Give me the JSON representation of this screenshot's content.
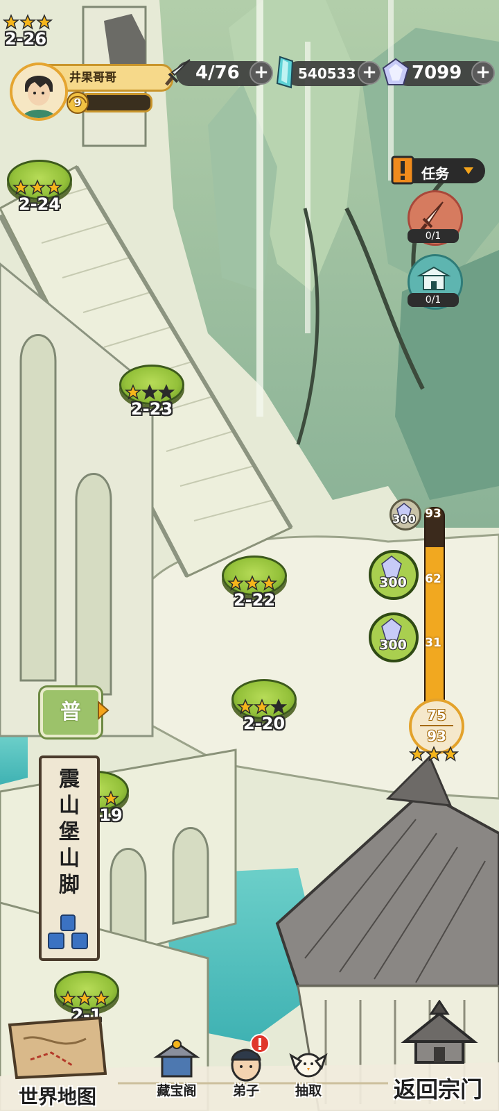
{
  "player": {
    "name": "井果哥哥",
    "level": "9",
    "exp_fraction": 0.08
  },
  "resources": {
    "stamina": {
      "value": "4/76",
      "icon": "sword-icon"
    },
    "jade": {
      "value": "540533",
      "icon": "jade-crystal-icon"
    },
    "gems": {
      "value": "7099",
      "icon": "gem-icon"
    }
  },
  "quest": {
    "label": "任务",
    "items": [
      {
        "icon": "sword-icon",
        "count": "0/1"
      },
      {
        "icon": "temple-icon",
        "count": "0/1"
      }
    ]
  },
  "stages": [
    {
      "id": "s26",
      "label": "2-26",
      "stars": 3
    },
    {
      "id": "s24",
      "label": "2-24",
      "stars": 3
    },
    {
      "id": "s23",
      "label": "2-23",
      "stars": 1
    },
    {
      "id": "s22",
      "label": "2-22",
      "stars": 3
    },
    {
      "id": "s20",
      "label": "2-20",
      "stars": 2
    },
    {
      "id": "s19",
      "label": "19",
      "stars": 3
    },
    {
      "id": "s1x",
      "label": "2-1",
      "stars": 3
    }
  ],
  "progress": {
    "current": "75",
    "total": "93",
    "milestones": [
      {
        "value": "93",
        "reward": "300"
      },
      {
        "value": "62",
        "reward": "300"
      },
      {
        "value": "31",
        "reward": "300"
      }
    ],
    "fraction": 0.806
  },
  "mode_badge": "普",
  "area_name": [
    "震",
    "山",
    "堡",
    "山",
    "脚"
  ],
  "bottom_nav": {
    "world_map": "世界地图",
    "treasure": "藏宝阁",
    "disciples": "弟子",
    "draw": "抽取",
    "return": "返回宗门"
  },
  "colors": {
    "pad_green": "#94c13a",
    "star_gold": "#f5b51b",
    "bar_orange": "#f1a820",
    "bg_mist": "#e9eddc"
  }
}
